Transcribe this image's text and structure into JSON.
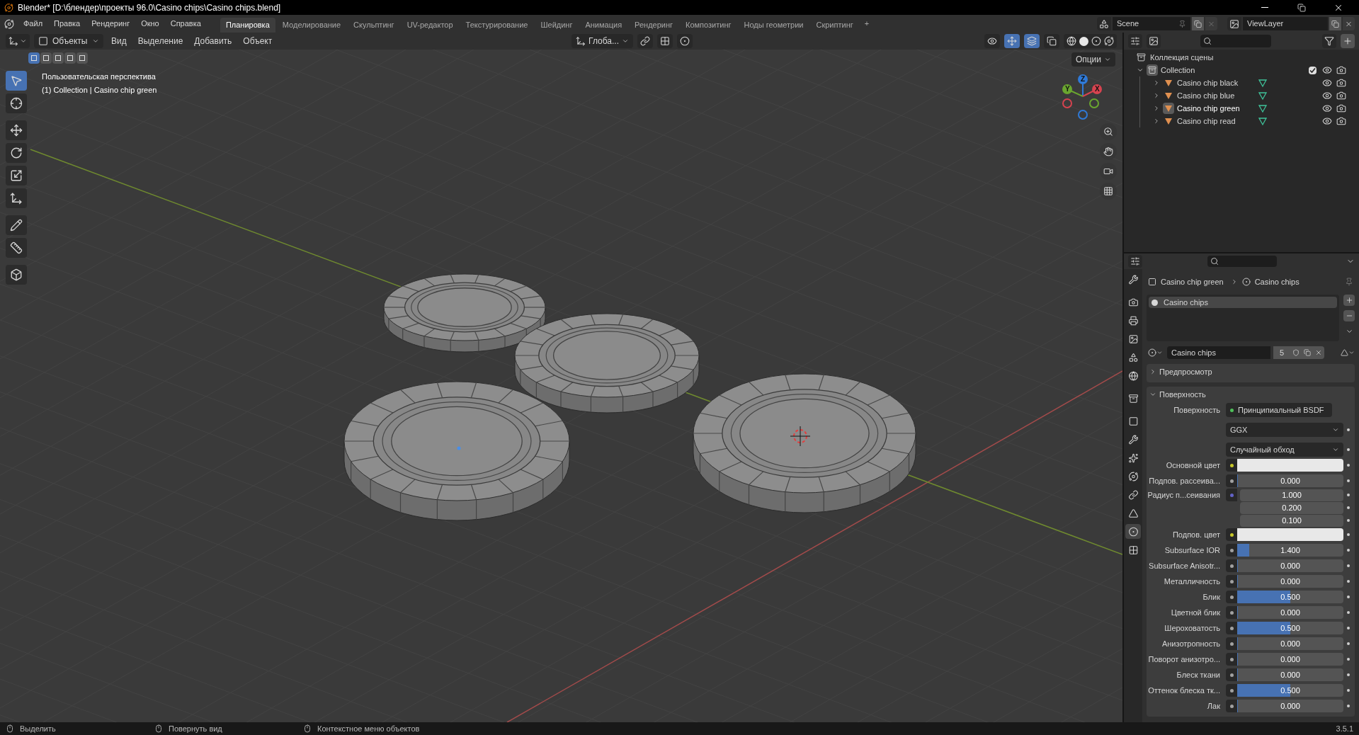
{
  "window": {
    "title": "Blender* [D:\\блендер\\проекты 96.0\\Casino chips\\Casino chips.blend]"
  },
  "menu": [
    "Файл",
    "Правка",
    "Рендеринг",
    "Окно",
    "Справка"
  ],
  "workspaces": [
    {
      "label": "Планировка",
      "selected": true
    },
    {
      "label": "Моделирование",
      "selected": false
    },
    {
      "label": "Скульптинг",
      "selected": false
    },
    {
      "label": "UV-редактор",
      "selected": false
    },
    {
      "label": "Текстурирование",
      "selected": false
    },
    {
      "label": "Шейдинг",
      "selected": false
    },
    {
      "label": "Анимация",
      "selected": false
    },
    {
      "label": "Рендеринг",
      "selected": false
    },
    {
      "label": "Композитинг",
      "selected": false
    },
    {
      "label": "Ноды геометрии",
      "selected": false
    },
    {
      "label": "Скриптинг",
      "selected": false
    }
  ],
  "add_workspace": "+",
  "scene": {
    "name": "Scene"
  },
  "view_layer": {
    "name": "ViewLayer"
  },
  "viewport": {
    "mode": "Объекты",
    "menus": [
      "Вид",
      "Выделение",
      "Добавить",
      "Объект"
    ],
    "orientation": "Глоба...",
    "options": "Опции",
    "select_modes": [
      {
        "selected": true
      },
      {
        "selected": false
      },
      {
        "selected": false
      },
      {
        "selected": false
      },
      {
        "selected": false
      }
    ],
    "tools": [
      {
        "kind": "select",
        "selected": true
      },
      {
        "kind": "cursor",
        "selected": false
      },
      {
        "kind": "move",
        "selected": false
      },
      {
        "kind": "rotate",
        "selected": false
      },
      {
        "kind": "scale",
        "selected": false
      },
      {
        "kind": "transform",
        "selected": false
      },
      {
        "kind": "annotate",
        "selected": false
      },
      {
        "kind": "measure",
        "selected": false
      },
      {
        "kind": "add",
        "selected": false
      }
    ],
    "view_name": "Пользовательская перспектива",
    "context": "(1) Collection | Casino chip green",
    "gizmo": {
      "axes": [
        "Z",
        "Y",
        "X"
      ]
    }
  },
  "outliner": {
    "root": "Коллекция сцены",
    "collection": {
      "name": "Collection",
      "expanded": true,
      "checked": true,
      "children": [
        {
          "name": "Casino chip black",
          "selected": false
        },
        {
          "name": "Casino chip blue",
          "selected": false
        },
        {
          "name": "Casino chip green",
          "selected": true
        },
        {
          "name": "Casino chip read",
          "selected": false
        }
      ]
    }
  },
  "properties": {
    "tabs": [
      {
        "kind": "tool",
        "selected": false
      },
      {
        "kind": "render",
        "selected": false
      },
      {
        "kind": "output",
        "selected": false
      },
      {
        "kind": "view_layer",
        "selected": false
      },
      {
        "kind": "scene",
        "selected": false
      },
      {
        "kind": "world",
        "selected": false
      },
      {
        "kind": "collection",
        "selected": false
      },
      {
        "kind": "object",
        "selected": false
      },
      {
        "kind": "modifiers",
        "selected": false
      },
      {
        "kind": "particles",
        "selected": false
      },
      {
        "kind": "physics",
        "selected": false
      },
      {
        "kind": "constraints",
        "selected": false
      },
      {
        "kind": "data",
        "selected": false
      },
      {
        "kind": "material",
        "selected": true
      },
      {
        "kind": "texture",
        "selected": false
      }
    ],
    "breadcrumb": [
      "Casino chip green",
      "Casino chips"
    ],
    "slots": [
      {
        "name": "Casino chips",
        "selected": true
      }
    ],
    "material": {
      "name": "Casino chips",
      "users": "5"
    },
    "panels": [
      {
        "title": "Предпросмотр",
        "expanded": false
      },
      {
        "title": "Поверхность",
        "expanded": true,
        "rows": [
          {
            "kind": "link",
            "label": "Поверхность",
            "value": "Принципиальный BSDF"
          },
          {
            "kind": "dropdown",
            "value": "GGX"
          },
          {
            "kind": "dropdown",
            "value": "Случайный обход"
          },
          {
            "kind": "color",
            "label": "Основной цвет",
            "color": "#e8e8e8"
          },
          {
            "kind": "slider",
            "label": "Подпов. рассеива...",
            "value": "0.000",
            "level": 0
          },
          {
            "kind": "vector",
            "label": "Радиус п...сеивания",
            "values": [
              "1.000",
              "0.200",
              "0.100"
            ]
          },
          {
            "kind": "color",
            "label": "Подпов. цвет",
            "color": "#e8e8e8"
          },
          {
            "kind": "slider",
            "label": "Subsurface IOR",
            "value": "1.400",
            "level": 0.11
          },
          {
            "kind": "slider",
            "label": "Subsurface Anisotr...",
            "value": "0.000",
            "level": 0
          },
          {
            "kind": "slider",
            "label": "Металличность",
            "value": "0.000",
            "level": 0
          },
          {
            "kind": "slider",
            "label": "Блик",
            "value": "0.500",
            "level": 0.5
          },
          {
            "kind": "slider",
            "label": "Цветной блик",
            "value": "0.000",
            "level": 0
          },
          {
            "kind": "slider",
            "label": "Шероховатость",
            "value": "0.500",
            "level": 0.5
          },
          {
            "kind": "slider",
            "label": "Анизотропность",
            "value": "0.000",
            "level": 0
          },
          {
            "kind": "slider",
            "label": "Поворот анизотро...",
            "value": "0.000",
            "level": 0
          },
          {
            "kind": "slider",
            "label": "Блеск ткани",
            "value": "0.000",
            "level": 0
          },
          {
            "kind": "slider",
            "label": "Оттенок блеска тк...",
            "value": "0.500",
            "level": 0.5
          },
          {
            "kind": "slider",
            "label": "Лак",
            "value": "0.000",
            "level": 0
          }
        ]
      }
    ]
  },
  "status_bar": {
    "hints": [
      "Выделить",
      "Повернуть вид",
      "Контекстное меню объектов"
    ],
    "version": "3.5.1"
  }
}
